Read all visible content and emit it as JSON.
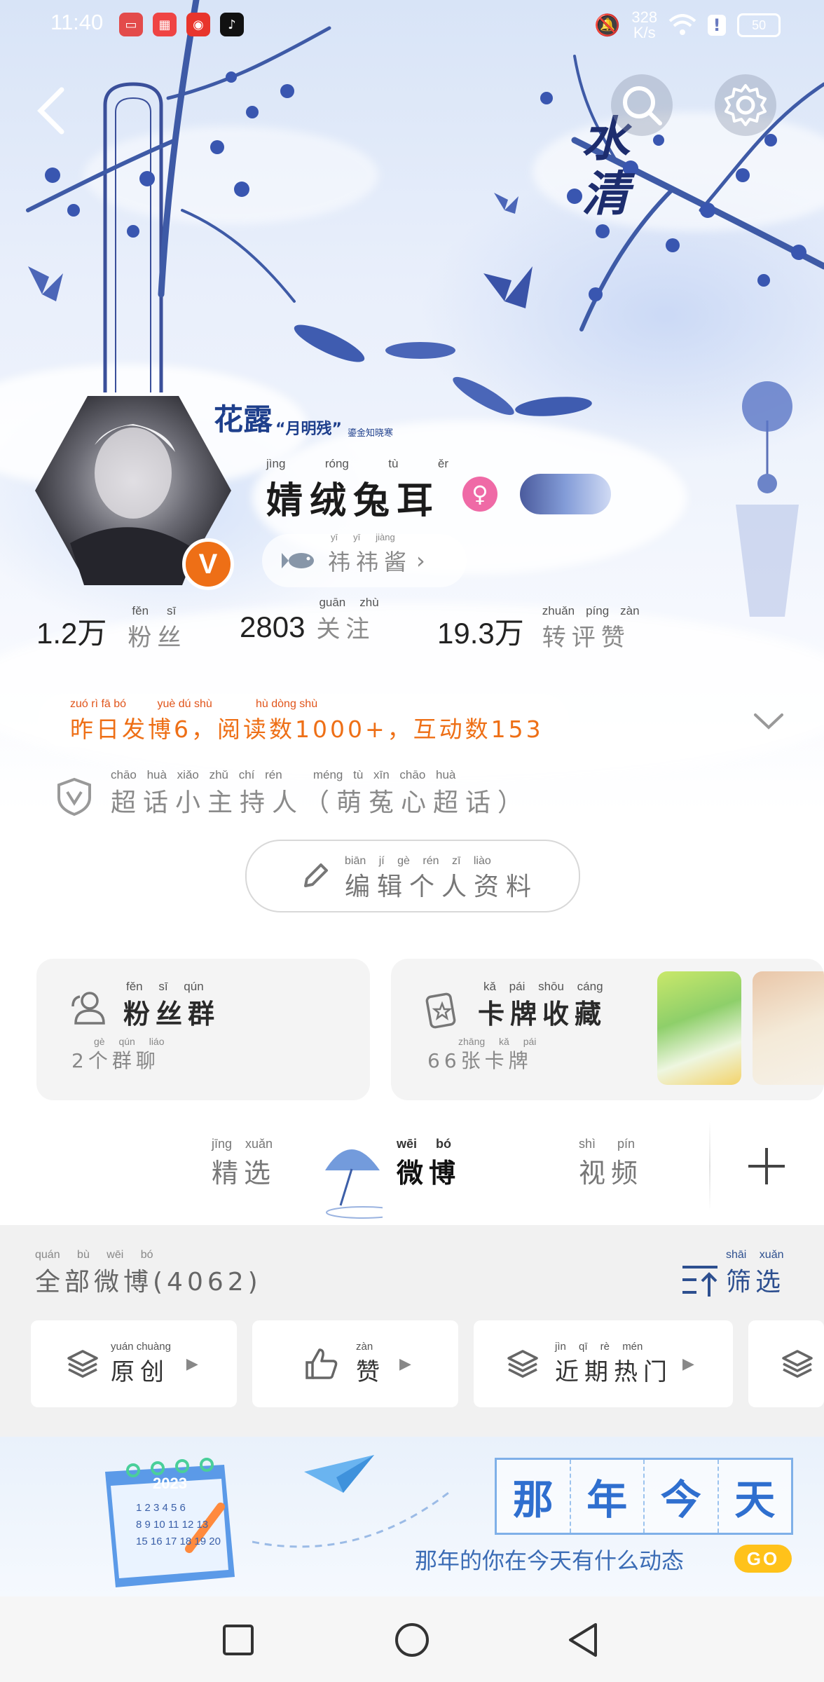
{
  "status_bar": {
    "time": "11:40",
    "net_speed_value": "328",
    "net_speed_unit": "K/s",
    "battery": "50"
  },
  "hero": {
    "calligraphy": "水清",
    "badge_title": "花露",
    "badge_quote": "“月明残”",
    "badge_tag": "鎏金知晓寒"
  },
  "profile": {
    "name": "婧绒兔耳",
    "name_pinyin": [
      "jìng",
      "róng",
      "tù",
      "ěr"
    ],
    "nickname": "祎祎酱",
    "nickname_pinyin": [
      "yī",
      "yī",
      "jiàng"
    ],
    "verified_mark": "V"
  },
  "stats": [
    {
      "value": "1.2万",
      "label": "粉丝",
      "pinyin": [
        "fěn",
        "sī"
      ]
    },
    {
      "value": "2803",
      "label": "关注",
      "pinyin": [
        "guān",
        "zhù"
      ]
    },
    {
      "value": "19.3万",
      "label": "转评赞",
      "pinyin": [
        "zhuǎn",
        "píng",
        "zàn"
      ]
    }
  ],
  "activity": {
    "text": "昨日发博6，阅读数1000+，互动数153",
    "pinyin_text": "zuó rì fā bó          yuè dú shù              hù dòng shù"
  },
  "super_topic": {
    "text": "超话小主持人（萌菟心超话）",
    "pinyin_text": "chāo huà xiǎo zhǔ chí rén   méng tù xīn chāo huà"
  },
  "edit_profile": {
    "label": "编辑个人资料",
    "pinyin_text": "biān jí gè rén zī liào"
  },
  "cards": {
    "fans_group": {
      "title": "粉丝群",
      "title_pinyin": "fěn sī qún",
      "subtitle": "2个群聊",
      "subtitle_pinyin": "gè qún liáo"
    },
    "card_collection": {
      "title": "卡牌收藏",
      "title_pinyin": "kǎ pái shōu cáng",
      "subtitle": "66张卡牌",
      "subtitle_pinyin": "zhāng kǎ pái"
    }
  },
  "tabs": [
    {
      "label": "精选",
      "pinyin": "jīng xuǎn",
      "active": false
    },
    {
      "label": "微博",
      "pinyin": "wēi bó",
      "active": true
    },
    {
      "label": "视频",
      "pinyin": "shì pín",
      "active": false
    }
  ],
  "feed_header": {
    "label": "全部微博(4062)",
    "pinyin_text": "quán bù wēi bó",
    "filter_label": "筛选",
    "filter_pinyin": "shāi xuǎn"
  },
  "filter_chips": [
    {
      "label": "原创",
      "pinyin": "yuán chuàng"
    },
    {
      "label": "赞",
      "pinyin": "zàn"
    },
    {
      "label": "近期热门",
      "pinyin": "jìn qī rè mén"
    }
  ],
  "banner": {
    "title_chars": [
      "那",
      "年",
      "今",
      "天"
    ],
    "subtitle": "那年的你在今天有什么动态",
    "go_label": "GO",
    "calendar_year": "2023",
    "calendar_rows": [
      "1 2 3 4 5 6",
      "8 9 10 11 12 13",
      "15 16 17 18 19 20"
    ]
  },
  "colors": {
    "accent_orange": "#ee6f16",
    "female_pink": "#ef6aa6",
    "banner_blue": "#2f6fcf",
    "go_yellow": "#ffc21a"
  }
}
